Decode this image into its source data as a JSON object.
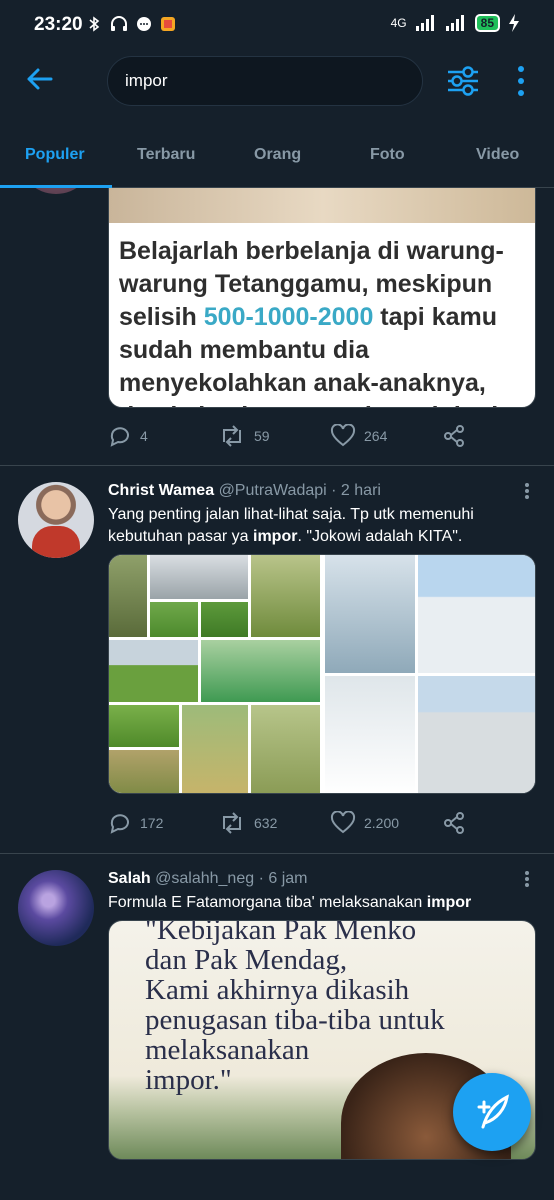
{
  "status": {
    "time": "23:20",
    "network": "4G",
    "battery": "85"
  },
  "search": {
    "query": "impor"
  },
  "tabs": [
    "Populer",
    "Terbaru",
    "Orang",
    "Foto",
    "Video"
  ],
  "tweet1": {
    "image_lines": [
      "Belajarlah berbelanja di warung-",
      "warung Tetanggamu, meskipun",
      "selisih ",
      "500-1000-2000",
      " tapi kamu",
      "sudah membantu dia",
      "menyekolahkan anak-anaknya,",
      "dan kalau kamu meninggal dunia"
    ],
    "replies": "4",
    "retweets": "59",
    "likes": "264"
  },
  "tweet2": {
    "name": "Christ Wamea",
    "handle": "@PutraWadapi",
    "time": "· 2 hari",
    "text_before": "Yang penting jalan lihat-lihat saja. Tp utk memenuhi kebutuhan pasar ya ",
    "text_highlight": "impor",
    "text_after": ". \"Jokowi adalah KITA\".",
    "replies": "172",
    "retweets": "632",
    "likes": "2.200"
  },
  "tweet3": {
    "name": "Salah",
    "handle": "@salahh_neg",
    "time": "· 6 jam",
    "text_before": "Formula E Fatamorgana tiba' melaksanakan ",
    "text_highlight": "impor",
    "image_lines": [
      "\"Kebijakan Pak Menko",
      "dan Pak Mendag,",
      "Kami akhirnya dikasih",
      "penugasan tiba-tiba untuk",
      "melaksanakan",
      "impor.\""
    ]
  },
  "colors": {
    "background": "#15202b",
    "accent": "#1da1f2",
    "muted": "#8899a6",
    "divider": "#38444d"
  }
}
